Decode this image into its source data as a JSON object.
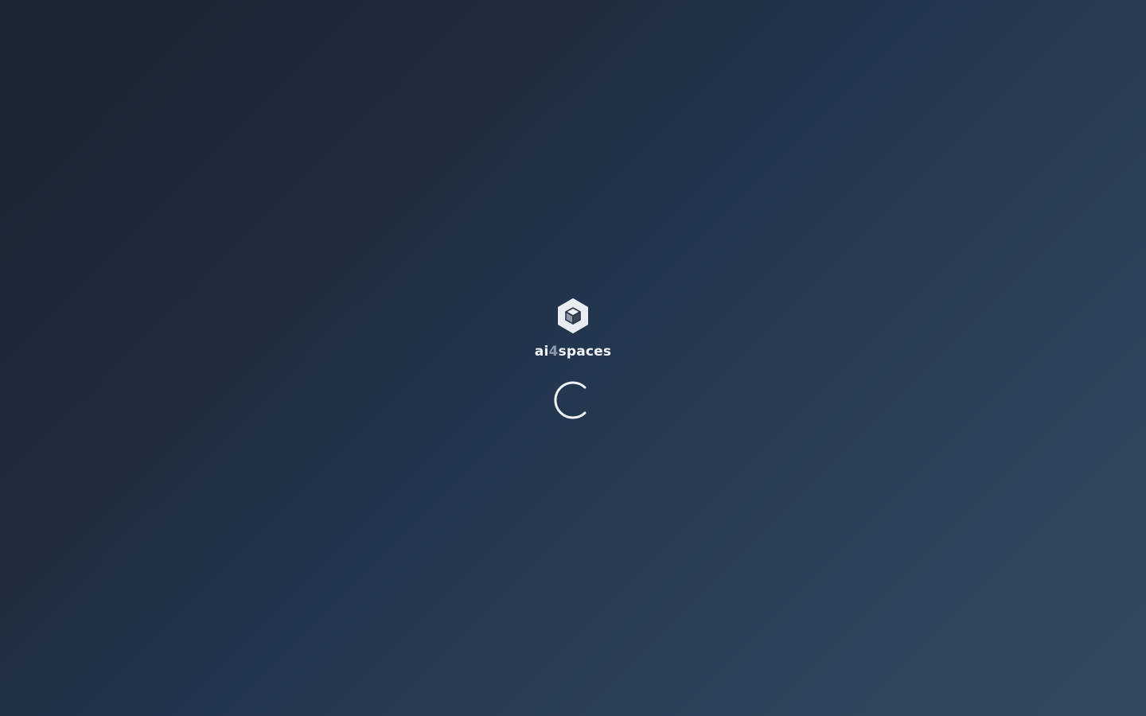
{
  "brand": {
    "name_prefix": "ai",
    "name_digit": "4",
    "name_suffix": "spaces",
    "logo_icon": "hexagon-cube-icon"
  },
  "loading": {
    "indicator_icon": "loading-spinner-icon"
  },
  "colors": {
    "text": "#f1f3f6",
    "digit_accent": "#8c99ab",
    "background_start": "#1b2432",
    "background_end": "#34495f"
  }
}
